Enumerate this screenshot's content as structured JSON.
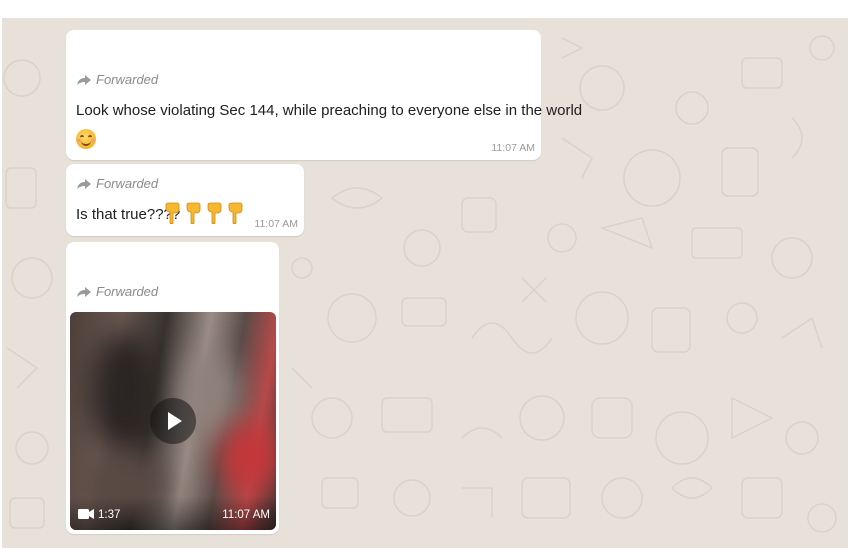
{
  "colors": {
    "wallpaper": "#e8e1d9",
    "bubble": "#ffffff",
    "meta_text": "#9a9a9a",
    "message_text": "#202020"
  },
  "messages": [
    {
      "forwarded_label": "Forwarded",
      "text": "Look whose violating Sec 144, while preaching to everyone else in the world",
      "emoji": "smiling-face-icon",
      "time": "11:07 AM"
    },
    {
      "forwarded_label": "Forwarded",
      "text": "Is that true????",
      "emoji": "backhand-index-pointing-down-icon",
      "emoji_count": 4,
      "time": "11:07 AM"
    },
    {
      "forwarded_label": "Forwarded",
      "video": {
        "duration": "1:37",
        "time": "11:07 AM",
        "icon": "play-icon"
      }
    }
  ]
}
